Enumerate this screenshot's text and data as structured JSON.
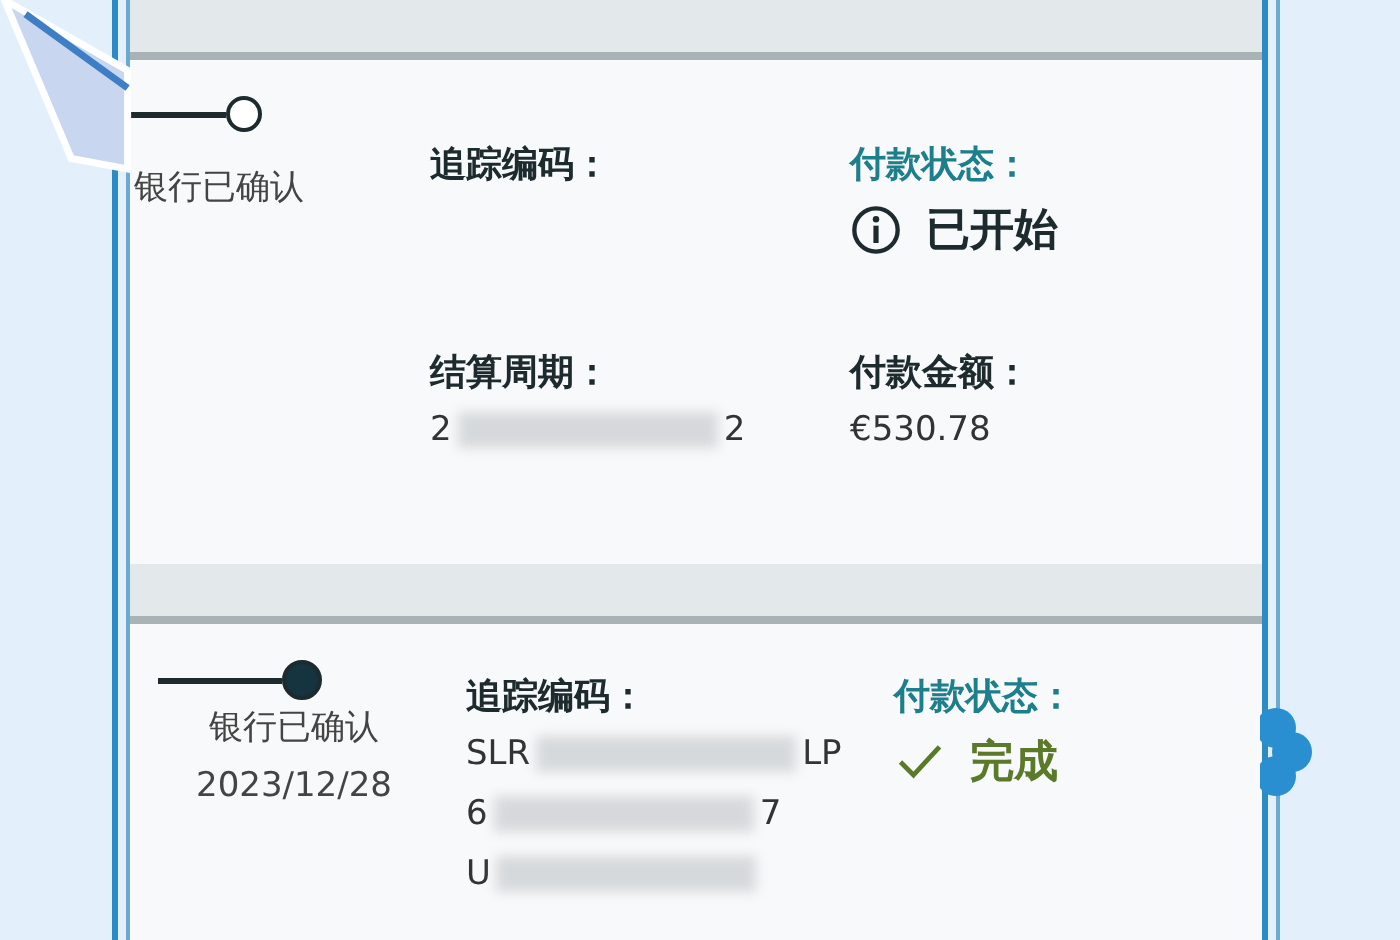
{
  "payments": [
    {
      "step": {
        "label": "银行已确认",
        "reached": false
      },
      "tracking": {
        "label": "追踪编码："
      },
      "period": {
        "label": "结算周期：",
        "prefix": "2",
        "suffix": "2"
      },
      "status": {
        "label": "付款状态：",
        "kind": "started",
        "text": "已开始"
      },
      "amount": {
        "label": "付款金额：",
        "value": "€530.78"
      }
    },
    {
      "step": {
        "label": "银行已确认",
        "date": "2023/12/28",
        "reached": true
      },
      "tracking": {
        "label": "追踪编码：",
        "lines": [
          {
            "prefix": "SLR",
            "suffix": "LP"
          },
          {
            "prefix": "6",
            "suffix": "7"
          },
          {
            "prefix": "U"
          }
        ]
      },
      "status": {
        "label": "付款状态：",
        "kind": "complete",
        "text": "完成"
      }
    }
  ]
}
